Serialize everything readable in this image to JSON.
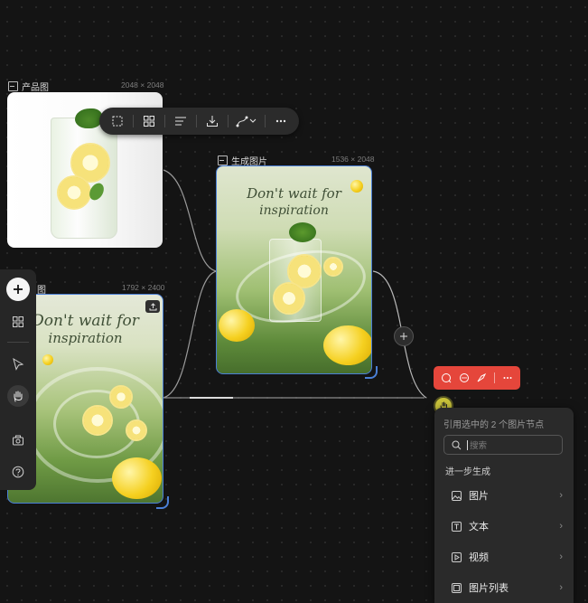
{
  "nodes": {
    "product": {
      "label": "产品图",
      "dims": "2048 × 2048"
    },
    "generated": {
      "label": "生成图片",
      "dims": "1536 × 2048"
    },
    "left_bottom": {
      "label": "图",
      "dims": "1792 × 2400"
    }
  },
  "art": {
    "line1": "Don't wait for",
    "line2": "inspiration"
  },
  "toolbar": {
    "icons": [
      "crop-icon",
      "grid-icon",
      "align-icon",
      "download-icon",
      "connector-icon",
      "more-icon"
    ]
  },
  "left_toolbar": {
    "icons": [
      "add-icon",
      "grid-icon",
      "pointer-icon",
      "hand-icon",
      "camera-icon",
      "help-icon"
    ]
  },
  "red_toolbar": {
    "icons": [
      "chat-icon",
      "message-icon",
      "brush-icon",
      "more-icon"
    ],
    "color": "#e5463b"
  },
  "menu": {
    "header": "引用选中的 2 个图片节点",
    "search_placeholder": "搜索",
    "section_label": "进一步生成",
    "items": [
      {
        "label": "图片",
        "icon": "image-icon"
      },
      {
        "label": "文本",
        "icon": "text-icon"
      },
      {
        "label": "视频",
        "icon": "video-icon"
      },
      {
        "label": "图片列表",
        "icon": "image-list-icon"
      }
    ]
  },
  "colors": {
    "accent_blue": "#4a7fd6",
    "red": "#e5463b",
    "cursor": "#c8c23a"
  }
}
